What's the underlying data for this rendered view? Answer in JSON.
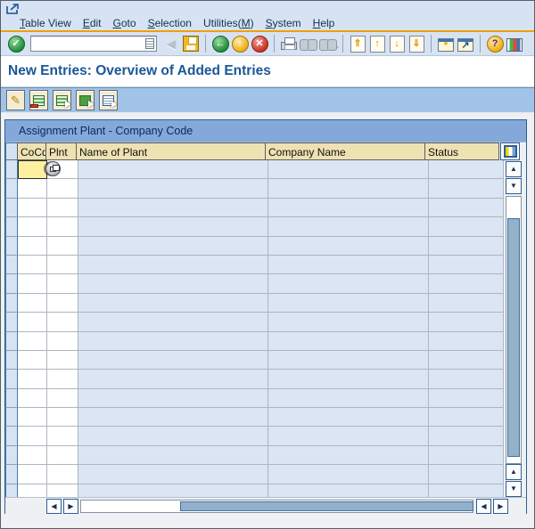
{
  "header": {
    "title": "New Entries: Overview of Added Entries"
  },
  "menu_bar": {
    "items": [
      {
        "label": "Table View",
        "underline_index": 0
      },
      {
        "label": "Edit",
        "underline_index": 0
      },
      {
        "label": "Goto",
        "underline_index": 0
      },
      {
        "label": "Selection",
        "underline_index": 0
      },
      {
        "label": "Utilities(M)",
        "underline_index": 10
      },
      {
        "label": "System",
        "underline_index": 0
      },
      {
        "label": "Help",
        "underline_index": 0
      }
    ]
  },
  "toolbar": {
    "command_field": {
      "value": "",
      "placeholder": ""
    }
  },
  "table": {
    "caption": "Assignment Plant - Company Code",
    "columns": [
      "CoCd",
      "Plnt",
      "Name of Plant",
      "Company Name",
      "Status"
    ],
    "visible_row_count": 18,
    "rows": []
  },
  "colors": {
    "accent_orange": "#eda203",
    "toolbar_bg": "#d7e3f3",
    "app_toolbar_bg": "#a2c3e8",
    "title_text": "#1a5796",
    "caption_bar_bg": "#84a8d9",
    "column_header_bg": "#efe2b2",
    "focused_cell_bg": "#fff0a0",
    "readonly_cell_bg": "#dbe5f3",
    "scroll_thumb": "#93b1cb"
  }
}
